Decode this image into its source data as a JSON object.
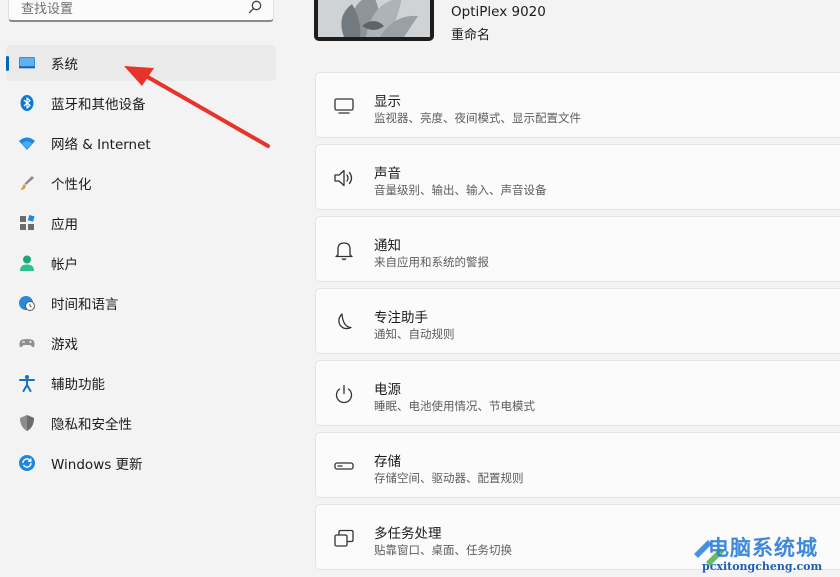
{
  "search": {
    "placeholder": "查找设置"
  },
  "sidebar": {
    "items": [
      {
        "label": "系统",
        "icon": "monitor-icon"
      },
      {
        "label": "蓝牙和其他设备",
        "icon": "bluetooth-icon"
      },
      {
        "label": "网络 & Internet",
        "icon": "wifi-icon"
      },
      {
        "label": "个性化",
        "icon": "brush-icon"
      },
      {
        "label": "应用",
        "icon": "apps-icon"
      },
      {
        "label": "帐户",
        "icon": "person-icon"
      },
      {
        "label": "时间和语言",
        "icon": "globe-clock-icon"
      },
      {
        "label": "游戏",
        "icon": "gamepad-icon"
      },
      {
        "label": "辅助功能",
        "icon": "accessibility-icon"
      },
      {
        "label": "隐私和安全性",
        "icon": "shield-icon"
      },
      {
        "label": "Windows 更新",
        "icon": "update-icon"
      }
    ]
  },
  "device": {
    "name": "OptiPlex 9020",
    "rename": "重命名"
  },
  "main": {
    "cards": [
      {
        "title": "显示",
        "subtitle": "监视器、亮度、夜间模式、显示配置文件",
        "icon": "display-icon"
      },
      {
        "title": "声音",
        "subtitle": "音量级别、输出、输入、声音设备",
        "icon": "speaker-icon"
      },
      {
        "title": "通知",
        "subtitle": "来自应用和系统的警报",
        "icon": "bell-icon"
      },
      {
        "title": "专注助手",
        "subtitle": "通知、自动规则",
        "icon": "moon-icon"
      },
      {
        "title": "电源",
        "subtitle": "睡眠、电池使用情况、节电模式",
        "icon": "power-icon"
      },
      {
        "title": "存储",
        "subtitle": "存储空间、驱动器、配置规则",
        "icon": "storage-icon"
      },
      {
        "title": "多任务处理",
        "subtitle": "贴靠窗口、桌面、任务切换",
        "icon": "multitask-icon"
      }
    ]
  },
  "watermark": {
    "title": "电脑系统城",
    "url": "pcxitongcheng.com"
  },
  "colors": {
    "accent": "#0067c0",
    "annotation": "#e8332a",
    "background": "#f3f3f3"
  }
}
